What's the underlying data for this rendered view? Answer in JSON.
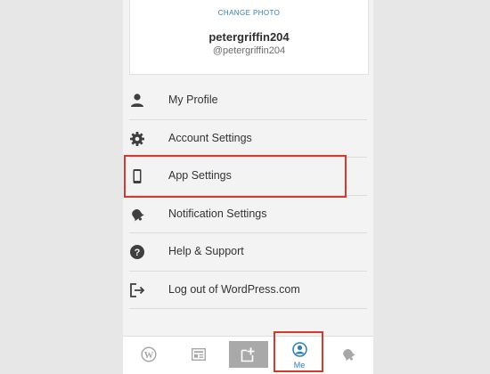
{
  "profile": {
    "change_photo": "CHANGE PHOTO",
    "username": "petergriffin204",
    "handle": "@petergriffin204"
  },
  "menu": {
    "items": [
      {
        "label": "My Profile",
        "icon": "person-icon"
      },
      {
        "label": "Account Settings",
        "icon": "gear-icon"
      },
      {
        "label": "App Settings",
        "icon": "phone-icon"
      },
      {
        "label": "Notification Settings",
        "icon": "bell-icon"
      },
      {
        "label": "Help & Support",
        "icon": "help-icon"
      },
      {
        "label": "Log out of WordPress.com",
        "icon": "logout-icon"
      }
    ]
  },
  "tabbar": {
    "tabs": [
      {
        "icon": "wordpress-icon"
      },
      {
        "icon": "reader-icon"
      },
      {
        "icon": "new-post-icon"
      },
      {
        "icon": "me-icon",
        "label": "Me",
        "active": true
      },
      {
        "icon": "notifications-bell-icon"
      }
    ]
  },
  "colors": {
    "accent": "#2e7fb8",
    "highlight": "#d63a2f",
    "icon": "#3f3f3f",
    "tab_icon": "#a7a7a7"
  }
}
